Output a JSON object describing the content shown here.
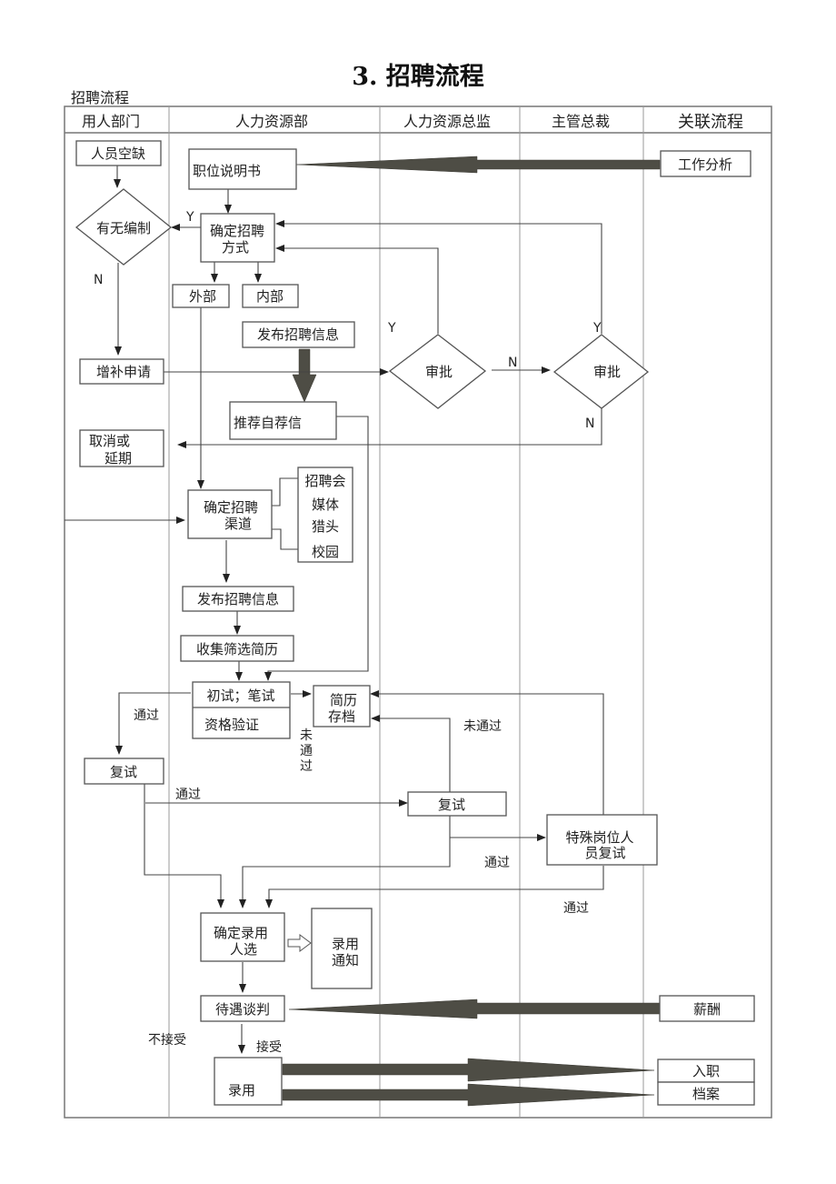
{
  "title": "3. 招聘流程",
  "subtitle": "招聘流程",
  "lanes": [
    "用人部门",
    "人力资源部",
    "人力资源总监",
    "主管总裁",
    "关联流程"
  ],
  "nodes": {
    "vacancy": "人员空缺",
    "has_quota": "有无编制",
    "add_request": "增补申请",
    "cancel_or_delay": [
      "取消或",
      "延期"
    ],
    "job_desc": "职位说明书",
    "decide_method": [
      "确定招聘",
      "方式"
    ],
    "external": "外部",
    "internal": "内部",
    "publish_info_internal": "发布招聘信息",
    "recommend_letter": "推荐自荐信",
    "decide_channel": [
      "确定招聘",
      "渠道"
    ],
    "channels": [
      "招聘会",
      "媒体",
      "猎头",
      "校园"
    ],
    "publish_info": "发布招聘信息",
    "collect_resumes": "收集筛选简历",
    "first_test": "初试；笔试",
    "qualification": "资格验证",
    "resume_archive": [
      "简历",
      "存档"
    ],
    "retest_dept": "复试",
    "retest_hrd": "复试",
    "approve_hrd": "审批",
    "approve_ceo": "审批",
    "special_retest": [
      "特殊岗位人",
      "员复试"
    ],
    "decide_hire": [
      "确定录用",
      "人选"
    ],
    "offer_notice": [
      "录用",
      "通知"
    ],
    "salary_negotiation": "待遇谈判",
    "hire": "录用",
    "job_analysis": "工作分析",
    "compensation": "薪酬",
    "onboarding": "入职",
    "archive": "档案"
  },
  "labels": {
    "yes": "Y",
    "no": "N",
    "pass": "通过",
    "fail": "未通过",
    "fail_vertical": [
      "未",
      "通",
      "过"
    ],
    "accept": "接受",
    "reject": "不接受"
  }
}
